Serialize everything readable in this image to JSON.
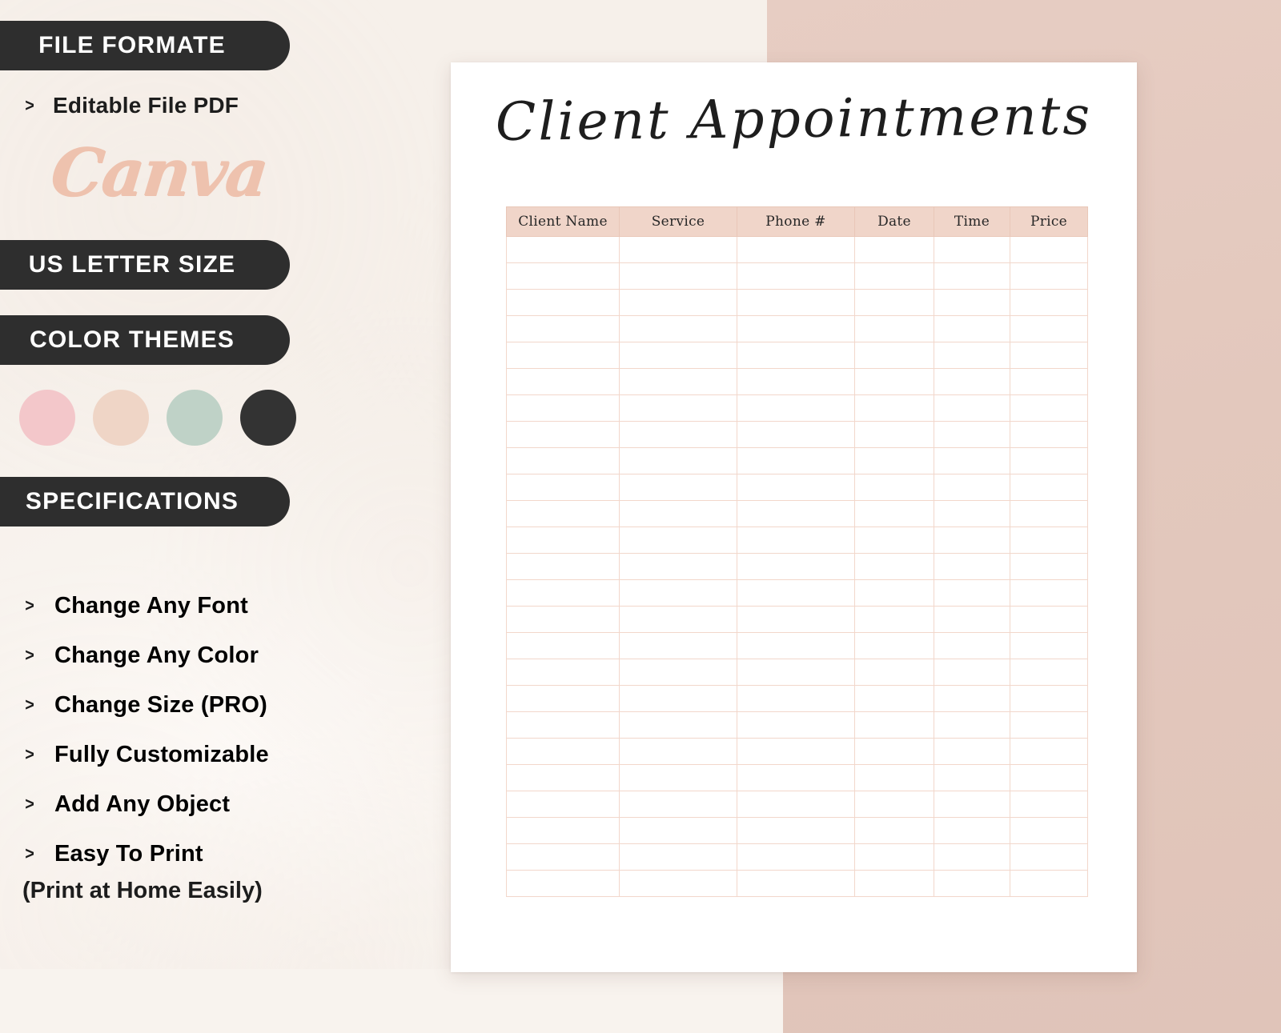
{
  "background": {
    "cream": "#f8f3ee",
    "pink_block": "#e3c8bd"
  },
  "sidebar": {
    "badges": [
      {
        "id": "file-formate",
        "label": "FILE FORMATE"
      },
      {
        "id": "us-letter-size",
        "label": "US LETTER SIZE"
      },
      {
        "id": "color-themes",
        "label": "COLOR THEMES"
      },
      {
        "id": "specifications",
        "label": "SPECIFICATIONS"
      }
    ],
    "file_format": {
      "bullet": ">",
      "item": "Editable File PDF",
      "brand_logo": "Canva",
      "brand_color": "#eec2ae"
    },
    "color_themes": {
      "swatches": [
        {
          "name": "blush-pink",
          "hex": "#f3c7ca"
        },
        {
          "name": "peach-nude",
          "hex": "#efd5c6"
        },
        {
          "name": "sage-green",
          "hex": "#bfd2c7"
        },
        {
          "name": "charcoal",
          "hex": "#333333"
        }
      ]
    },
    "specifications": {
      "bullet": ">",
      "items": [
        "Change Any Font",
        "Change Any Color",
        "Change Size (PRO)",
        "Fully Customizable",
        "Add Any Object",
        "Easy To Print"
      ],
      "note": "(Print at Home Easily)"
    }
  },
  "page": {
    "title": "Client Appointments",
    "table": {
      "headers": [
        "Client Name",
        "Service",
        "Phone #",
        "Date",
        "Time",
        "Price"
      ],
      "row_count": 25,
      "header_bg": "#f0d5c9",
      "grid_color": "#f2d7cb"
    }
  }
}
